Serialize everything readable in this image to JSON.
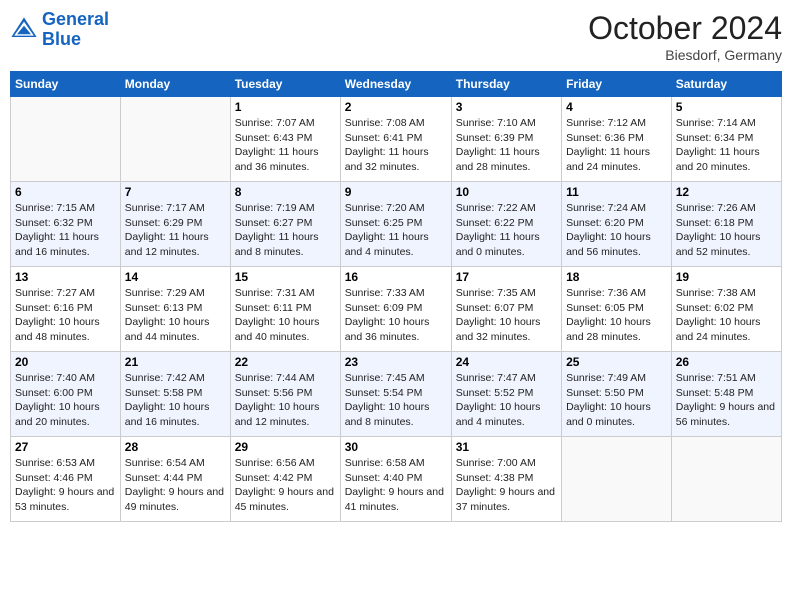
{
  "header": {
    "logo_line1": "General",
    "logo_line2": "Blue",
    "month": "October 2024",
    "location": "Biesdorf, Germany"
  },
  "weekdays": [
    "Sunday",
    "Monday",
    "Tuesday",
    "Wednesday",
    "Thursday",
    "Friday",
    "Saturday"
  ],
  "weeks": [
    [
      {
        "day": "",
        "sunrise": "",
        "sunset": "",
        "daylight": ""
      },
      {
        "day": "",
        "sunrise": "",
        "sunset": "",
        "daylight": ""
      },
      {
        "day": "1",
        "sunrise": "Sunrise: 7:07 AM",
        "sunset": "Sunset: 6:43 PM",
        "daylight": "Daylight: 11 hours and 36 minutes."
      },
      {
        "day": "2",
        "sunrise": "Sunrise: 7:08 AM",
        "sunset": "Sunset: 6:41 PM",
        "daylight": "Daylight: 11 hours and 32 minutes."
      },
      {
        "day": "3",
        "sunrise": "Sunrise: 7:10 AM",
        "sunset": "Sunset: 6:39 PM",
        "daylight": "Daylight: 11 hours and 28 minutes."
      },
      {
        "day": "4",
        "sunrise": "Sunrise: 7:12 AM",
        "sunset": "Sunset: 6:36 PM",
        "daylight": "Daylight: 11 hours and 24 minutes."
      },
      {
        "day": "5",
        "sunrise": "Sunrise: 7:14 AM",
        "sunset": "Sunset: 6:34 PM",
        "daylight": "Daylight: 11 hours and 20 minutes."
      }
    ],
    [
      {
        "day": "6",
        "sunrise": "Sunrise: 7:15 AM",
        "sunset": "Sunset: 6:32 PM",
        "daylight": "Daylight: 11 hours and 16 minutes."
      },
      {
        "day": "7",
        "sunrise": "Sunrise: 7:17 AM",
        "sunset": "Sunset: 6:29 PM",
        "daylight": "Daylight: 11 hours and 12 minutes."
      },
      {
        "day": "8",
        "sunrise": "Sunrise: 7:19 AM",
        "sunset": "Sunset: 6:27 PM",
        "daylight": "Daylight: 11 hours and 8 minutes."
      },
      {
        "day": "9",
        "sunrise": "Sunrise: 7:20 AM",
        "sunset": "Sunset: 6:25 PM",
        "daylight": "Daylight: 11 hours and 4 minutes."
      },
      {
        "day": "10",
        "sunrise": "Sunrise: 7:22 AM",
        "sunset": "Sunset: 6:22 PM",
        "daylight": "Daylight: 11 hours and 0 minutes."
      },
      {
        "day": "11",
        "sunrise": "Sunrise: 7:24 AM",
        "sunset": "Sunset: 6:20 PM",
        "daylight": "Daylight: 10 hours and 56 minutes."
      },
      {
        "day": "12",
        "sunrise": "Sunrise: 7:26 AM",
        "sunset": "Sunset: 6:18 PM",
        "daylight": "Daylight: 10 hours and 52 minutes."
      }
    ],
    [
      {
        "day": "13",
        "sunrise": "Sunrise: 7:27 AM",
        "sunset": "Sunset: 6:16 PM",
        "daylight": "Daylight: 10 hours and 48 minutes."
      },
      {
        "day": "14",
        "sunrise": "Sunrise: 7:29 AM",
        "sunset": "Sunset: 6:13 PM",
        "daylight": "Daylight: 10 hours and 44 minutes."
      },
      {
        "day": "15",
        "sunrise": "Sunrise: 7:31 AM",
        "sunset": "Sunset: 6:11 PM",
        "daylight": "Daylight: 10 hours and 40 minutes."
      },
      {
        "day": "16",
        "sunrise": "Sunrise: 7:33 AM",
        "sunset": "Sunset: 6:09 PM",
        "daylight": "Daylight: 10 hours and 36 minutes."
      },
      {
        "day": "17",
        "sunrise": "Sunrise: 7:35 AM",
        "sunset": "Sunset: 6:07 PM",
        "daylight": "Daylight: 10 hours and 32 minutes."
      },
      {
        "day": "18",
        "sunrise": "Sunrise: 7:36 AM",
        "sunset": "Sunset: 6:05 PM",
        "daylight": "Daylight: 10 hours and 28 minutes."
      },
      {
        "day": "19",
        "sunrise": "Sunrise: 7:38 AM",
        "sunset": "Sunset: 6:02 PM",
        "daylight": "Daylight: 10 hours and 24 minutes."
      }
    ],
    [
      {
        "day": "20",
        "sunrise": "Sunrise: 7:40 AM",
        "sunset": "Sunset: 6:00 PM",
        "daylight": "Daylight: 10 hours and 20 minutes."
      },
      {
        "day": "21",
        "sunrise": "Sunrise: 7:42 AM",
        "sunset": "Sunset: 5:58 PM",
        "daylight": "Daylight: 10 hours and 16 minutes."
      },
      {
        "day": "22",
        "sunrise": "Sunrise: 7:44 AM",
        "sunset": "Sunset: 5:56 PM",
        "daylight": "Daylight: 10 hours and 12 minutes."
      },
      {
        "day": "23",
        "sunrise": "Sunrise: 7:45 AM",
        "sunset": "Sunset: 5:54 PM",
        "daylight": "Daylight: 10 hours and 8 minutes."
      },
      {
        "day": "24",
        "sunrise": "Sunrise: 7:47 AM",
        "sunset": "Sunset: 5:52 PM",
        "daylight": "Daylight: 10 hours and 4 minutes."
      },
      {
        "day": "25",
        "sunrise": "Sunrise: 7:49 AM",
        "sunset": "Sunset: 5:50 PM",
        "daylight": "Daylight: 10 hours and 0 minutes."
      },
      {
        "day": "26",
        "sunrise": "Sunrise: 7:51 AM",
        "sunset": "Sunset: 5:48 PM",
        "daylight": "Daylight: 9 hours and 56 minutes."
      }
    ],
    [
      {
        "day": "27",
        "sunrise": "Sunrise: 6:53 AM",
        "sunset": "Sunset: 4:46 PM",
        "daylight": "Daylight: 9 hours and 53 minutes."
      },
      {
        "day": "28",
        "sunrise": "Sunrise: 6:54 AM",
        "sunset": "Sunset: 4:44 PM",
        "daylight": "Daylight: 9 hours and 49 minutes."
      },
      {
        "day": "29",
        "sunrise": "Sunrise: 6:56 AM",
        "sunset": "Sunset: 4:42 PM",
        "daylight": "Daylight: 9 hours and 45 minutes."
      },
      {
        "day": "30",
        "sunrise": "Sunrise: 6:58 AM",
        "sunset": "Sunset: 4:40 PM",
        "daylight": "Daylight: 9 hours and 41 minutes."
      },
      {
        "day": "31",
        "sunrise": "Sunrise: 7:00 AM",
        "sunset": "Sunset: 4:38 PM",
        "daylight": "Daylight: 9 hours and 37 minutes."
      },
      {
        "day": "",
        "sunrise": "",
        "sunset": "",
        "daylight": ""
      },
      {
        "day": "",
        "sunrise": "",
        "sunset": "",
        "daylight": ""
      }
    ]
  ]
}
